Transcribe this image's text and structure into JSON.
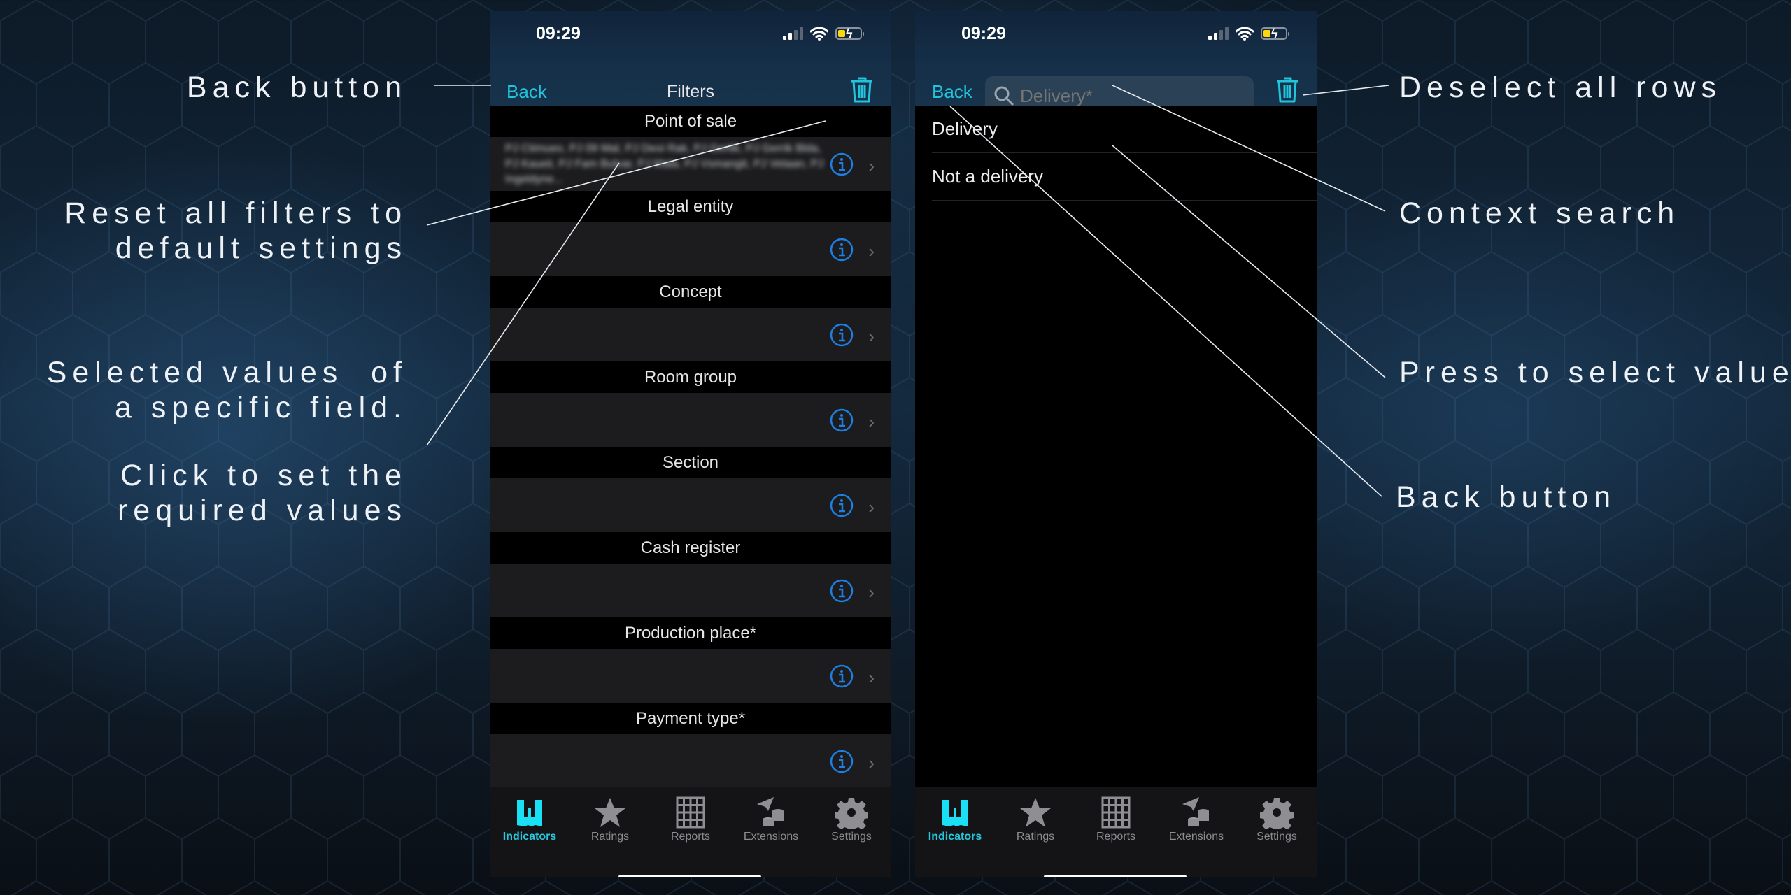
{
  "callouts": {
    "left": [
      {
        "id": "back-button",
        "text": "Back button"
      },
      {
        "id": "reset-filters",
        "text": "Reset all filters to\ndefault settings"
      },
      {
        "id": "selected-values",
        "text": "Selected values  of\na specific field."
      },
      {
        "id": "set-values",
        "text": "Click to set the\nrequired values"
      }
    ],
    "right": [
      {
        "id": "deselect-all",
        "text": "Deselect all rows"
      },
      {
        "id": "context-search",
        "text": "Context search"
      },
      {
        "id": "press-select",
        "text": "Press to select value"
      },
      {
        "id": "back-button",
        "text": "Back button"
      }
    ]
  },
  "status_bar": {
    "time": "09:29",
    "signal_bars_active": 2,
    "signal_bars_total": 4,
    "battery": "charging-low",
    "battery_color": "#ffd60a"
  },
  "accent_color": "#22c4dc",
  "filters_screen": {
    "back_label": "Back",
    "title": "Filters",
    "trash_icon": "trash-icon",
    "sections": [
      {
        "header": "Point of sale",
        "values": "PJ Ctimueo, PJ 09 Mal, PJ Deoi Rak, PJ Gertik, PJ Gerrik Blda, PJ Kaueii, PJ Fam Bulvar, PJ Mala, PJ Vsmangit, PJ Vetaan, PJ Ingeldyne..."
      },
      {
        "header": "Legal entity",
        "values": ""
      },
      {
        "header": "Concept",
        "values": ""
      },
      {
        "header": "Room group",
        "values": ""
      },
      {
        "header": "Section",
        "values": ""
      },
      {
        "header": "Cash register",
        "values": ""
      },
      {
        "header": "Production place*",
        "values": ""
      },
      {
        "header": "Payment type*",
        "values": ""
      }
    ]
  },
  "select_screen": {
    "back_label": "Back",
    "search_value": "",
    "search_placeholder": "Delivery*",
    "trash_icon": "trash-icon",
    "items": [
      "Delivery",
      "Not a delivery"
    ]
  },
  "tabbar": {
    "active": 0,
    "items": [
      {
        "label": "Indicators",
        "icon": "indicators-icon"
      },
      {
        "label": "Ratings",
        "icon": "star-icon"
      },
      {
        "label": "Reports",
        "icon": "grid-icon"
      },
      {
        "label": "Extensions",
        "icon": "extensions-icon"
      },
      {
        "label": "Settings",
        "icon": "gear-icon"
      }
    ]
  }
}
